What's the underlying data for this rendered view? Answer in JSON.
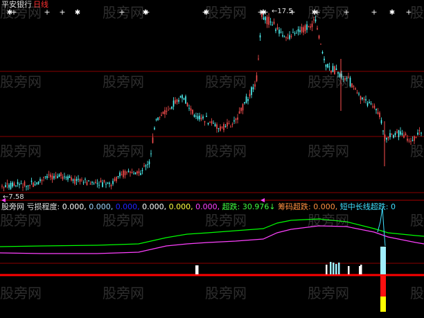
{
  "header": {
    "stock_name": "平安银行",
    "period": "日线"
  },
  "price_panel": {
    "high_label": "17.5",
    "low_label": "7.58",
    "signal_glyph": "+",
    "signal_glyph_alt": "✱"
  },
  "indicator": {
    "title": "股旁网",
    "name": "亏损程度",
    "values": [
      {
        "text": "0.000,",
        "color": "#ffffff"
      },
      {
        "text": "0.000,",
        "color": "#9fd6ff"
      },
      {
        "text": "0.000,",
        "color": "#2222ff"
      },
      {
        "text": "0.000,",
        "color": "#ffffff"
      },
      {
        "text": "0.000,",
        "color": "#ffff40"
      },
      {
        "text": "0.000,",
        "color": "#ff40ff"
      }
    ],
    "chaodie_label": "超跌:",
    "chaodie_value": "30.976↓",
    "choumachaodie_label": "筹码超跌:",
    "choumachaodie_value": "0.000,",
    "duanzhongchang_label": "短中长线超跌:",
    "duanzhongchang_value": "0"
  },
  "watermark": "股旁网",
  "colors": {
    "background": "#000000",
    "up_candle": "#ff5050",
    "down_candle": "#54ffff",
    "grid": "#8b0000",
    "separator": "#ff0000",
    "slow_line": "#00ff00",
    "fast_line": "#ff40ff",
    "signal": "#ffffff"
  }
}
